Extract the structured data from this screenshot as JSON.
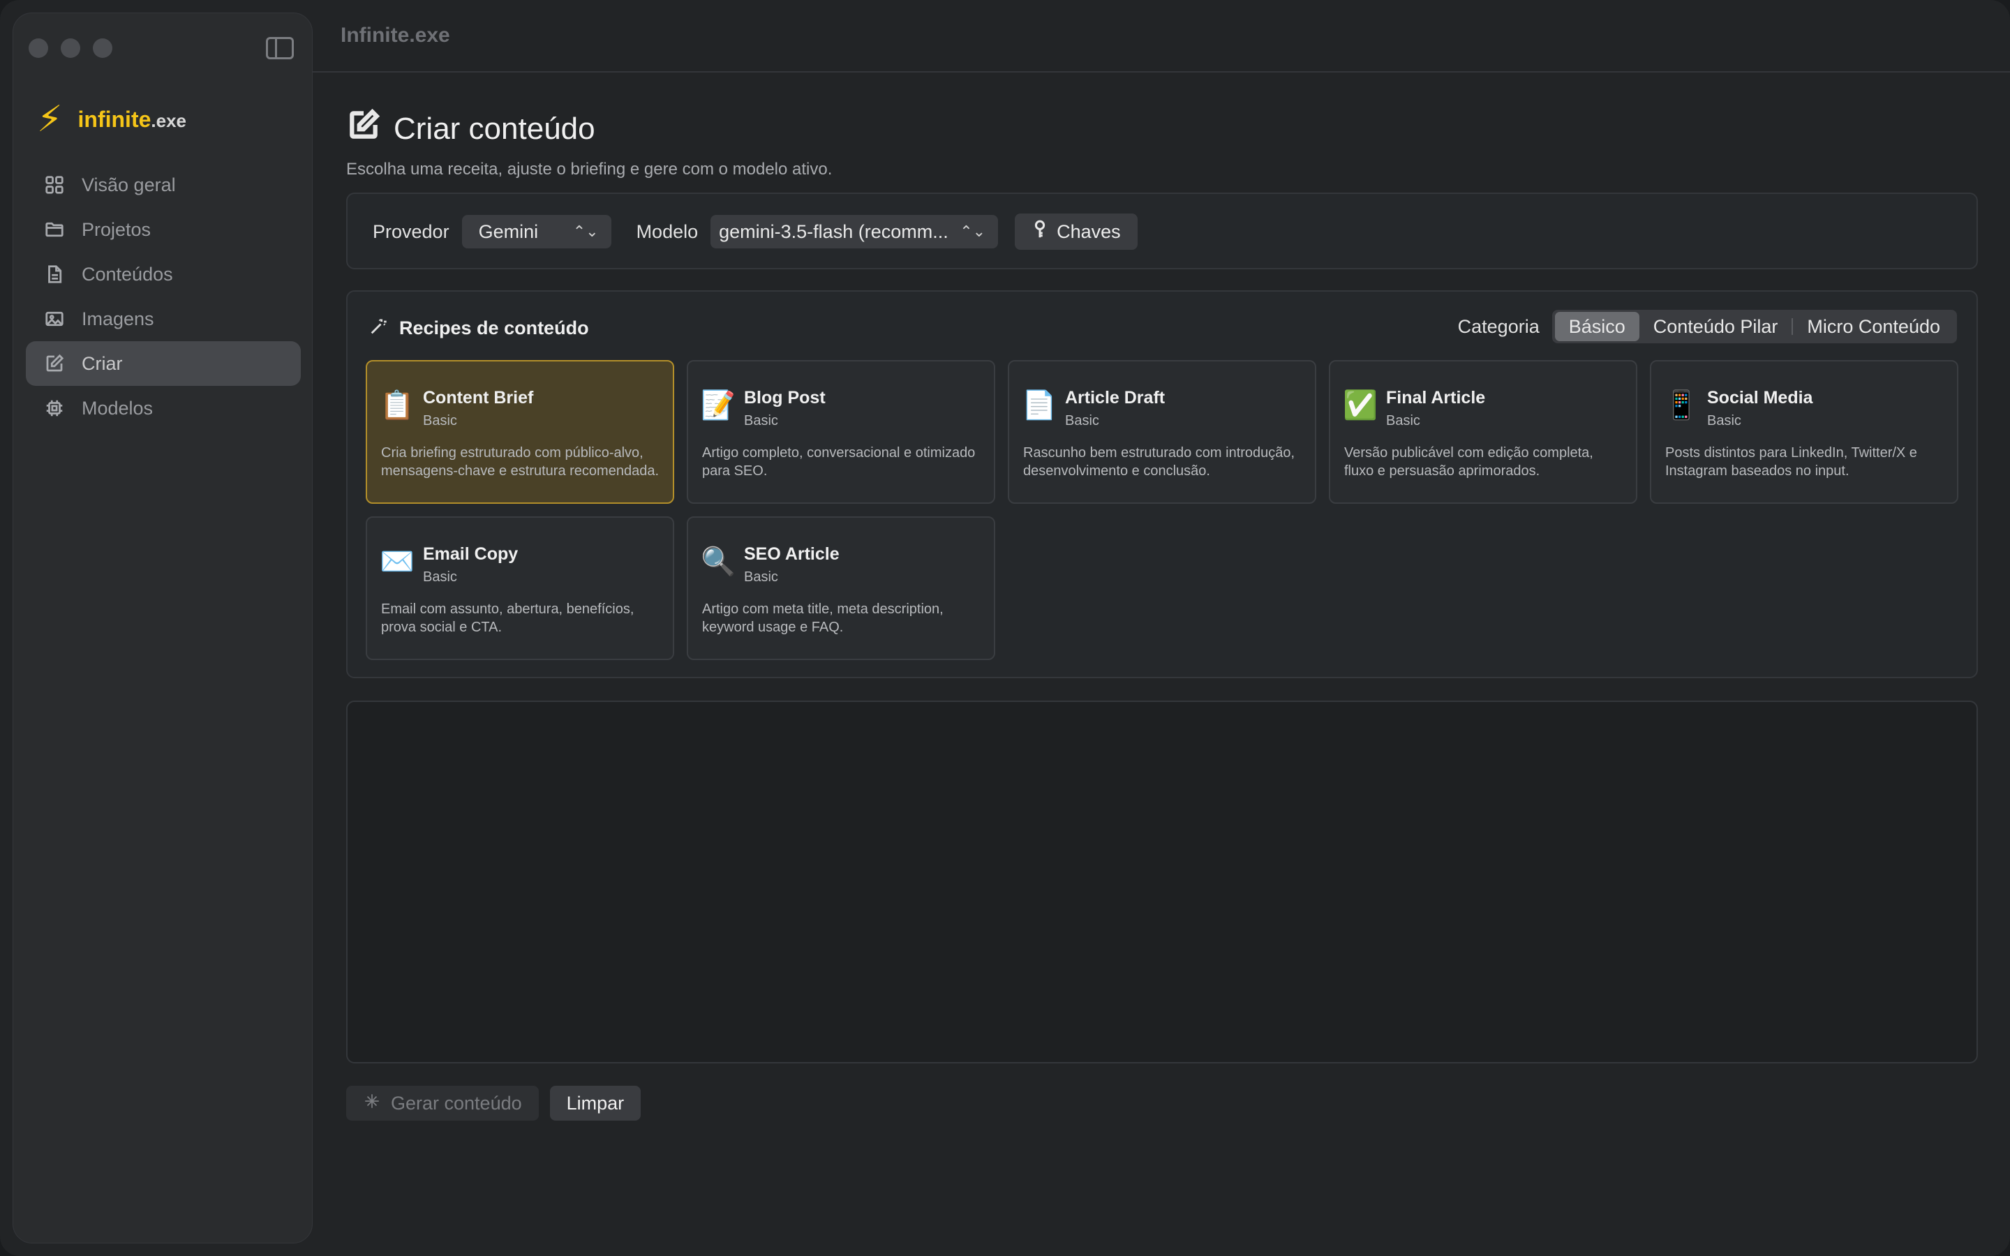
{
  "window": {
    "title": "Infinite.exe"
  },
  "brand": {
    "name": "infinite",
    "ext": ".exe"
  },
  "sidebar": {
    "items": [
      {
        "label": "Visão geral",
        "icon": "grid-icon"
      },
      {
        "label": "Projetos",
        "icon": "folder-icon"
      },
      {
        "label": "Conteúdos",
        "icon": "document-icon"
      },
      {
        "label": "Imagens",
        "icon": "image-icon"
      },
      {
        "label": "Criar",
        "icon": "edit-icon",
        "active": true
      },
      {
        "label": "Modelos",
        "icon": "chip-icon"
      }
    ]
  },
  "page": {
    "title": "Criar conteúdo",
    "subtitle": "Escolha uma receita, ajuste o briefing e gere com o modelo ativo."
  },
  "config": {
    "provider_label": "Provedor",
    "provider_value": "Gemini",
    "model_label": "Modelo",
    "model_value": "gemini-3.5-flash (recomm...",
    "keys_label": "Chaves"
  },
  "recipes": {
    "title": "Recipes de conteúdo",
    "category_label": "Categoria",
    "categories": [
      "Básico",
      "Conteúdo Pilar",
      "Micro Conteúdo"
    ],
    "selected_category": "Básico",
    "cards": [
      {
        "icon": "📋",
        "icon_name": "clipboard-icon",
        "title": "Content Brief",
        "tag": "Basic",
        "desc": "Cria briefing estruturado com público-alvo, mensagens-chave e estrutura recomendada.",
        "selected": true
      },
      {
        "icon": "📝",
        "icon_name": "memo-icon",
        "title": "Blog Post",
        "tag": "Basic",
        "desc": "Artigo completo, conversacional e otimizado para SEO."
      },
      {
        "icon": "📄",
        "icon_name": "page-icon",
        "title": "Article Draft",
        "tag": "Basic",
        "desc": "Rascunho bem estruturado com introdução, desenvolvimento e conclusão."
      },
      {
        "icon": "✅",
        "icon_name": "check-icon",
        "title": "Final Article",
        "tag": "Basic",
        "desc": "Versão publicável com edição completa, fluxo e persuasão aprimorados."
      },
      {
        "icon": "📱",
        "icon_name": "phone-icon",
        "title": "Social Media",
        "tag": "Basic",
        "desc": "Posts distintos para LinkedIn, Twitter/X e Instagram baseados no input."
      },
      {
        "icon": "✉️",
        "icon_name": "envelope-icon",
        "title": "Email Copy",
        "tag": "Basic",
        "desc": "Email com assunto, abertura, benefícios, prova social e CTA."
      },
      {
        "icon": "🔍",
        "icon_name": "magnifier-icon",
        "title": "SEO Article",
        "tag": "Basic",
        "desc": "Artigo com meta title, meta description, keyword usage e FAQ."
      }
    ]
  },
  "actions": {
    "generate_label": "Gerar conteúdo",
    "clear_label": "Limpar"
  }
}
